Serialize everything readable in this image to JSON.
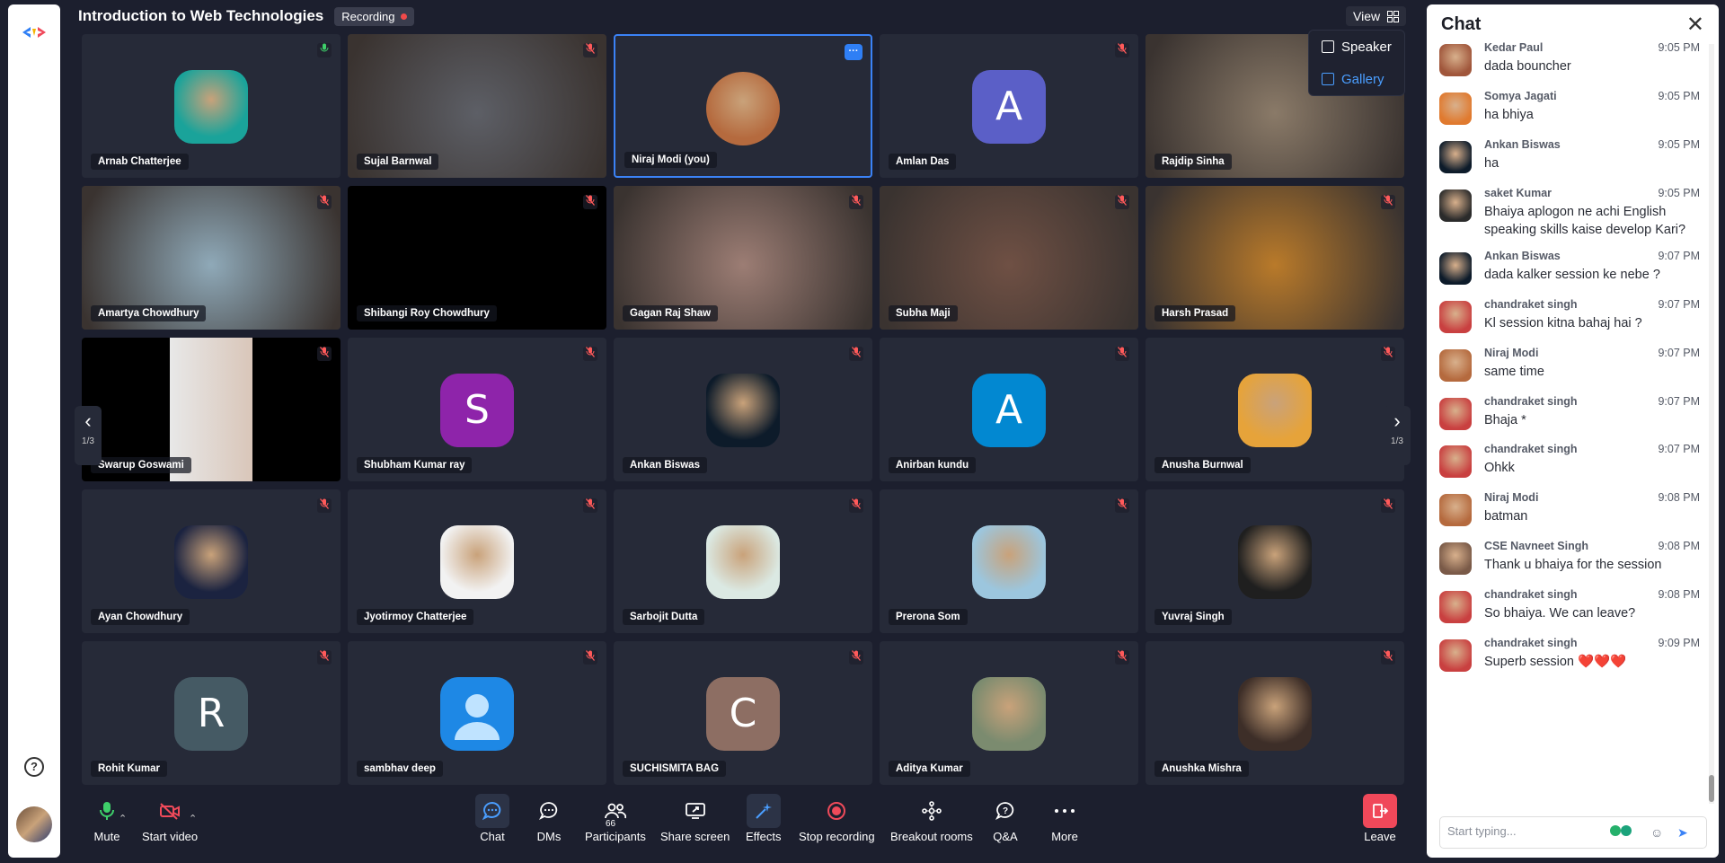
{
  "meeting": {
    "title": "Introduction to Web Technologies",
    "recording_label": "Recording",
    "view_label": "View",
    "view_options": [
      "Speaker",
      "Gallery"
    ],
    "selected_view": "Gallery"
  },
  "pager": {
    "left_label": "1/3",
    "right_label": "1/3"
  },
  "tiles": [
    {
      "name": "Arnab Chatterjee",
      "kind": "photo",
      "mic": "on",
      "color": "#1aa39a"
    },
    {
      "name": "Sujal Barnwal",
      "kind": "video",
      "mic": "off",
      "color": "#5d5f66"
    },
    {
      "name": "Niraj Modi (you)",
      "kind": "photo",
      "mic": "more",
      "color": "#b56a3e"
    },
    {
      "name": "Amlan Das",
      "kind": "letter",
      "letter": "A",
      "mic": "off",
      "color": "#5b5fc7"
    },
    {
      "name": "Rajdip Sinha",
      "kind": "video",
      "mic": "off",
      "color": "#8a7a68"
    },
    {
      "name": "Amartya Chowdhury",
      "kind": "video",
      "mic": "off",
      "color": "#8fa9b8"
    },
    {
      "name": "Shibangi Roy Chowdhury",
      "kind": "black",
      "mic": "off",
      "color": "#000000"
    },
    {
      "name": "Gagan Raj Shaw",
      "kind": "video",
      "mic": "off",
      "color": "#9c7d74"
    },
    {
      "name": "Subha Maji",
      "kind": "video",
      "mic": "off",
      "color": "#6f5044"
    },
    {
      "name": "Harsh Prasad",
      "kind": "video",
      "mic": "off",
      "color": "#b97a2a"
    },
    {
      "name": "Swarup Goswami",
      "kind": "video",
      "mic": "off",
      "color": "#e8e8e8"
    },
    {
      "name": "Shubham Kumar ray",
      "kind": "letter",
      "letter": "S",
      "mic": "off",
      "color": "#8e24aa"
    },
    {
      "name": "Ankan Biswas",
      "kind": "photo",
      "mic": "off",
      "color": "#0d1b2a"
    },
    {
      "name": "Anirban kundu",
      "kind": "letter",
      "letter": "A",
      "mic": "off",
      "color": "#0288d1"
    },
    {
      "name": "Anusha Burnwal",
      "kind": "photo",
      "mic": "off",
      "color": "#e6a33a"
    },
    {
      "name": "Ayan Chowdhury",
      "kind": "photo",
      "mic": "off",
      "color": "#1b2340"
    },
    {
      "name": "Jyotirmoy Chatterjee",
      "kind": "photo",
      "mic": "off",
      "color": "#f2f2f2"
    },
    {
      "name": "Sarbojit Dutta",
      "kind": "photo",
      "mic": "off",
      "color": "#dbe9e3"
    },
    {
      "name": "Prerona Som",
      "kind": "photo",
      "mic": "off",
      "color": "#9cc6de"
    },
    {
      "name": "Yuvraj Singh",
      "kind": "photo",
      "mic": "off",
      "color": "#1f1f1f"
    },
    {
      "name": "Rohit Kumar",
      "kind": "letter",
      "letter": "R",
      "mic": "off",
      "color": "#455a64"
    },
    {
      "name": "sambhav deep",
      "kind": "person",
      "mic": "off",
      "color": "#1e88e5"
    },
    {
      "name": "SUCHISMITA BAG",
      "kind": "letter",
      "letter": "C",
      "mic": "off",
      "color": "#8d6e63"
    },
    {
      "name": "Aditya Kumar",
      "kind": "photo",
      "mic": "off",
      "color": "#7b8b6f"
    },
    {
      "name": "Anushka Mishra",
      "kind": "photo",
      "mic": "off",
      "color": "#3d2e28"
    }
  ],
  "toolbar": {
    "mute": "Mute",
    "start_video": "Start video",
    "chat": "Chat",
    "dms": "DMs",
    "participants": "Participants",
    "participants_count": "66",
    "share_screen": "Share screen",
    "effects": "Effects",
    "stop_recording": "Stop recording",
    "breakout_rooms": "Breakout rooms",
    "qa": "Q&A",
    "more": "More",
    "leave": "Leave"
  },
  "chat": {
    "title": "Chat",
    "input_placeholder": "Start typing...",
    "messages": [
      {
        "sender": "Kedar Paul",
        "time": "9:05 PM",
        "text": "dada bouncher",
        "color": "#a0563b"
      },
      {
        "sender": "Somya Jagati",
        "time": "9:05 PM",
        "text": "ha bhiya",
        "color": "#e07a2f"
      },
      {
        "sender": "Ankan Biswas",
        "time": "9:05 PM",
        "text": "ha",
        "color": "#0d1b2a"
      },
      {
        "sender": "saket Kumar",
        "time": "9:05 PM",
        "text": "Bhaiya aplogon ne achi English speaking skills kaise develop Kari?",
        "color": "#2b2b2b"
      },
      {
        "sender": "Ankan Biswas",
        "time": "9:07 PM",
        "text": "dada kalker session ke nebe ?",
        "color": "#0d1b2a"
      },
      {
        "sender": "chandraket singh",
        "time": "9:07 PM",
        "text": "Kl session kitna bahaj hai ?",
        "color": "#c94040"
      },
      {
        "sender": "Niraj Modi",
        "time": "9:07 PM",
        "text": "same time",
        "color": "#b56a3e"
      },
      {
        "sender": "chandraket singh",
        "time": "9:07 PM",
        "text": "Bhaja *",
        "color": "#c94040"
      },
      {
        "sender": "chandraket singh",
        "time": "9:07 PM",
        "text": "Ohkk",
        "color": "#c94040"
      },
      {
        "sender": "Niraj Modi",
        "time": "9:08 PM",
        "text": "batman",
        "color": "#b56a3e"
      },
      {
        "sender": "CSE Navneet Singh",
        "time": "9:08 PM",
        "text": "Thank u bhaiya for the session",
        "color": "#7a5a48"
      },
      {
        "sender": "chandraket singh",
        "time": "9:08 PM",
        "text": "So bhaiya. We can leave?",
        "color": "#c94040"
      },
      {
        "sender": "chandraket singh",
        "time": "9:09 PM",
        "text": "Superb session ❤️❤️❤️",
        "color": "#c94040"
      }
    ]
  }
}
